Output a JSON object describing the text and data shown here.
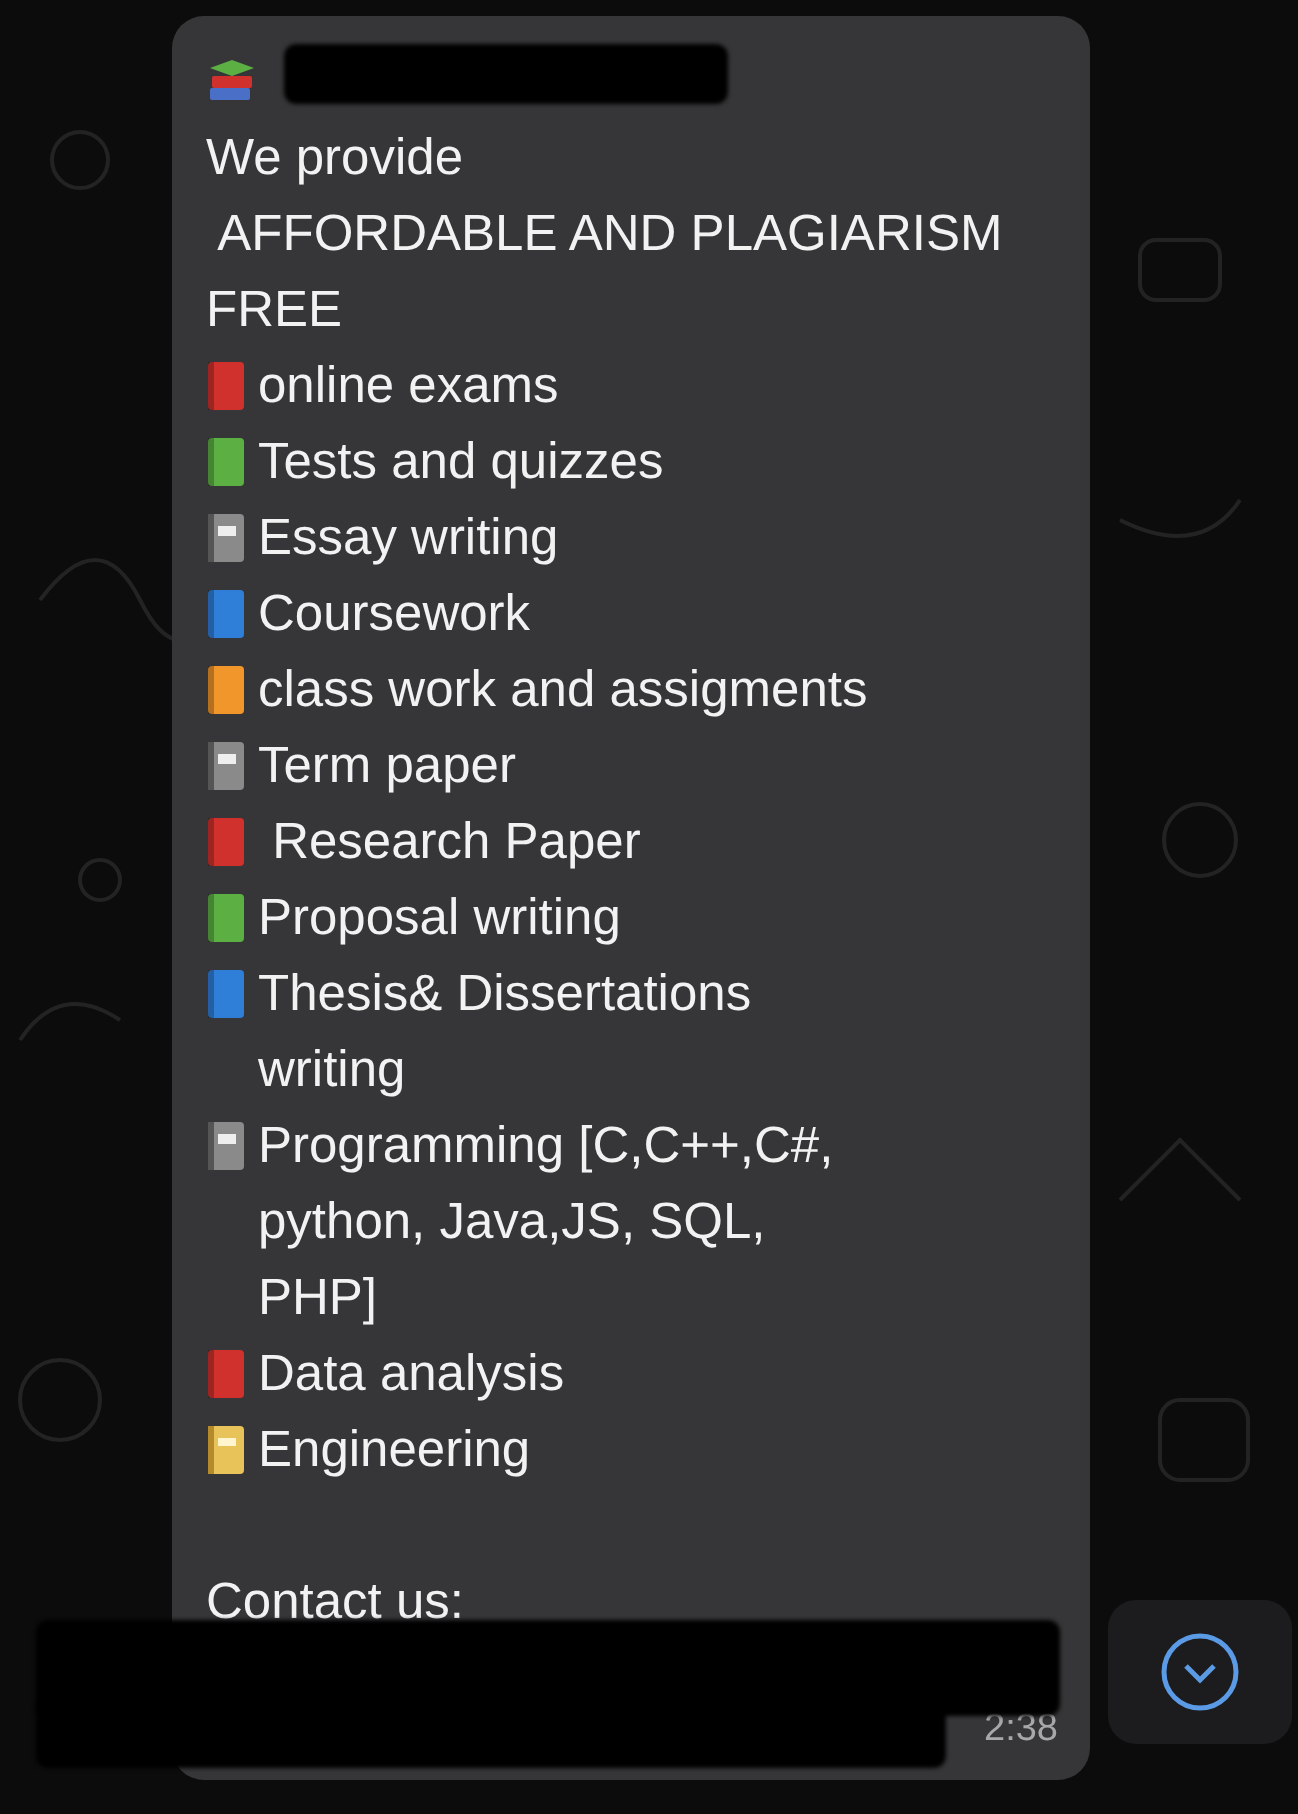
{
  "message": {
    "intro": "We provide",
    "headline": " AFFORDABLE AND PLAGIARISM",
    "headline_2": "FREE",
    "items": [
      {
        "lines": [
          "online exams"
        ],
        "color": "#d0312d",
        "kind": "book"
      },
      {
        "lines": [
          "Tests and quizzes"
        ],
        "color": "#5cb043",
        "kind": "book"
      },
      {
        "lines": [
          "Essay writing"
        ],
        "color": "#8a8a8a",
        "kind": "notebook"
      },
      {
        "lines": [
          "Coursework"
        ],
        "color": "#2f7fd8",
        "kind": "book"
      },
      {
        "lines": [
          "class work and assigments"
        ],
        "color": "#f0962a",
        "kind": "book"
      },
      {
        "lines": [
          "Term paper"
        ],
        "color": "#8a8a8a",
        "kind": "notebook"
      },
      {
        "lines": [
          " Research Paper"
        ],
        "color": "#d0312d",
        "kind": "book"
      },
      {
        "lines": [
          "Proposal writing"
        ],
        "color": "#5cb043",
        "kind": "book"
      },
      {
        "lines": [
          "Thesis& Dissertations",
          "writing"
        ],
        "color": "#2f7fd8",
        "kind": "book"
      },
      {
        "lines": [
          "Programming [C,C++,C#,",
          "python, Java,JS, SQL,",
          "PHP]"
        ],
        "color": "#8a8a8a",
        "kind": "notebook"
      },
      {
        "lines": [
          "Data analysis"
        ],
        "color": "#d0312d",
        "kind": "book"
      },
      {
        "lines": [
          "Engineering"
        ],
        "color": "#e8c35a",
        "kind": "ledger"
      }
    ],
    "contact": "Contact us:",
    "time": "2:38"
  }
}
